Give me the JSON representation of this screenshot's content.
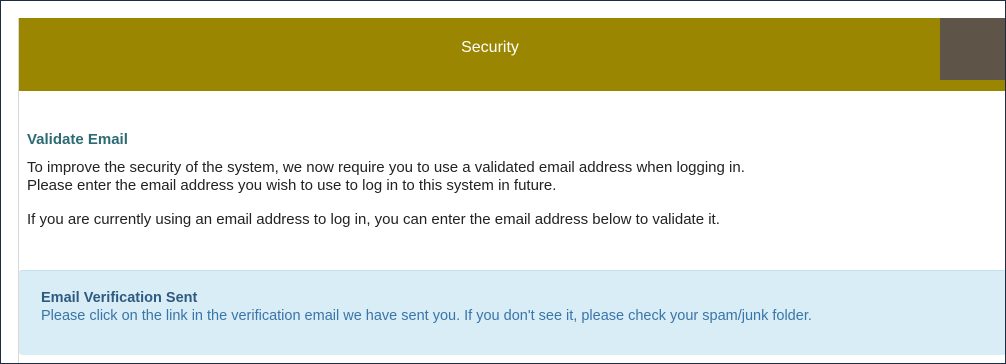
{
  "header": {
    "title": "Security",
    "colors": {
      "bar": "#9a8600",
      "block": "#5e5448"
    }
  },
  "validate": {
    "title": "Validate Email",
    "line1": "To improve the security of the system, we now require you to use a validated email address when logging in.",
    "line2": "Please enter the email address you wish to use to log in to this system in future.",
    "line3": "If you are currently using an email address to log in, you can enter the email address below to validate it."
  },
  "alert": {
    "title": "Email Verification Sent",
    "message": "Please click on the link in the verification email we have sent you. If you don't see it, please check your spam/junk folder.",
    "colors": {
      "background": "#d9edf7",
      "text": "#3a75a8"
    }
  }
}
